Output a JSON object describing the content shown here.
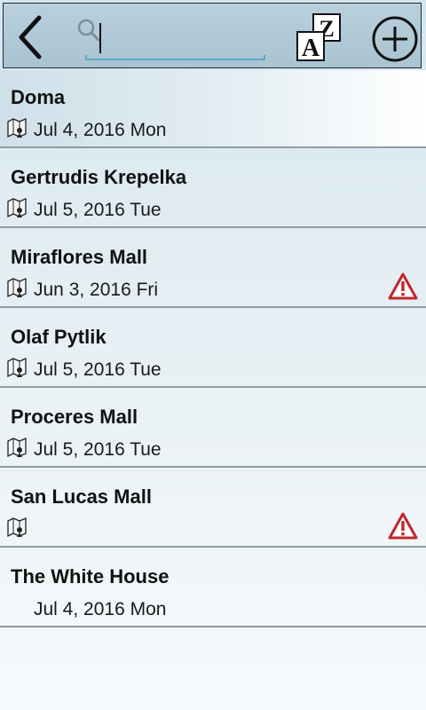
{
  "toolbar": {
    "search": {
      "value": "",
      "placeholder": ""
    }
  },
  "locations": [
    {
      "name": "Doma",
      "date": "Jul 4, 2016 Mon",
      "has_map_icon": true,
      "warning": false,
      "selected": true
    },
    {
      "name": "Gertrudis Krepelka",
      "date": "Jul 5, 2016 Tue",
      "has_map_icon": true,
      "warning": false
    },
    {
      "name": "Miraflores Mall",
      "date": "Jun 3, 2016 Fri",
      "has_map_icon": true,
      "warning": true
    },
    {
      "name": "Olaf Pytlik",
      "date": "Jul 5, 2016 Tue",
      "has_map_icon": true,
      "warning": false
    },
    {
      "name": "Proceres Mall",
      "date": "Jul 5, 2016 Tue",
      "has_map_icon": true,
      "warning": false
    },
    {
      "name": "San Lucas Mall",
      "date": "",
      "has_map_icon": true,
      "warning": true
    },
    {
      "name": "The White House",
      "date": "Jul 4, 2016 Mon",
      "has_map_icon": false,
      "warning": false
    }
  ],
  "colors": {
    "toolbar_bg": "#b0c9d6",
    "accent": "#5aa7c7",
    "warning_red": "#c0262b",
    "divider": "#8e9ca4"
  },
  "icons": {
    "back": "back-arrow-icon",
    "search": "search-icon",
    "sort": "sort-az-icon",
    "add": "add-circle-icon",
    "map": "map-pin-icon",
    "warning": "warning-icon"
  }
}
